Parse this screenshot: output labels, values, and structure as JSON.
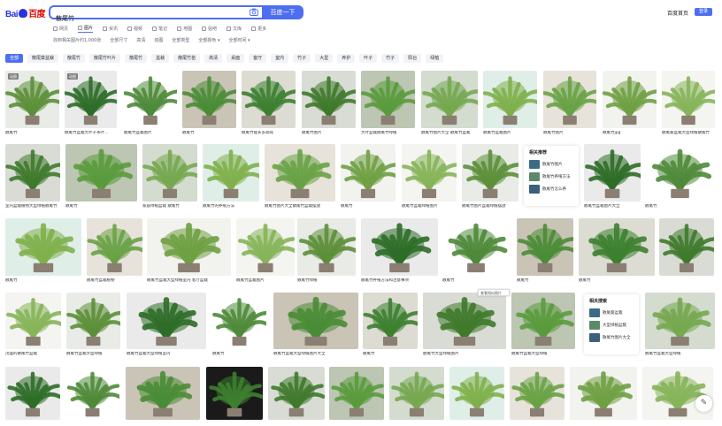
{
  "header": {
    "logo_bai": "Bai",
    "logo_du": "百度",
    "search_value": "散尾竹",
    "search_button": "百度一下",
    "top_link": "百度首页",
    "login": "登录"
  },
  "nav_tabs": [
    {
      "label": "网页",
      "active": false
    },
    {
      "label": "图片",
      "active": true
    },
    {
      "label": "资讯",
      "active": false
    },
    {
      "label": "视频",
      "active": false
    },
    {
      "label": "笔记",
      "active": false
    },
    {
      "label": "地图",
      "active": false
    },
    {
      "label": "贴吧",
      "active": false
    },
    {
      "label": "文库",
      "active": false
    },
    {
      "label": "更多",
      "active": false
    }
  ],
  "filters": [
    "找到相关图片约1,000张",
    "全部尺寸",
    "高清",
    "动图",
    "全部类型",
    "全部颜色 ▾",
    "全部时间 ▾"
  ],
  "chips": [
    "全部",
    "散尾葵盆栽",
    "散尾竹",
    "散尾竹叶片",
    "散尾竹",
    "盆栽",
    "散尾竹苗",
    "高清",
    "桌面",
    "客厅",
    "室内",
    "竹子",
    "大型",
    "养护",
    "叶子",
    "竹子",
    "阳台",
    "绿植"
  ],
  "captions_row1": [
    "散尾竹",
    "散尾竹盆栽大叶子茶叶...",
    "散尾竹盆栽图片",
    "散尾竹",
    "散尾竹能长多高呢",
    "散尾竹图片",
    "大叶盆栽散尾竹绿植",
    "散尾竹图片大全 散尾竹盆栽",
    "散尾竹盆栽图片",
    "散尾竹图片",
    "散尾竹jpg",
    "散尾葵盆栽大型绿植散尾竹"
  ],
  "captions_row2": [
    "室内盆栽植物大型绿植散尾竹",
    "散尾竹",
    "家居绿植盆栽 散尾竹",
    "散尾竹的养殖方法",
    "散尾竹图片大全散尾竹盆栽摆放",
    "散尾竹",
    "散尾竹盆栽绿植图片",
    "散尾竹图片盆栽绿植摆放",
    "散尾竹盆栽图片大全",
    "散尾竹"
  ],
  "captions_row3": [
    "散尾竹",
    "散尾竹盆栽植物",
    "散尾竹盆栽大型绿植室内 客厅盆栽",
    "散尾竹盆栽图片",
    "散尾竹绿植",
    "散尾竹养殖方法和注意事项",
    "散尾竹",
    "散尾竹",
    "散尾竹"
  ],
  "captions_row4": [
    "茂盛的散尾竹盆栽",
    "散尾竹盆栽大型绿植",
    "散尾竹盆栽大型绿植室内",
    "散尾竹",
    "散尾竹盆栽大型绿植图片大全",
    "散尾竹",
    "散尾竹大型绿植图片",
    "散尾竹盆栽大型绿植",
    "散尾竹盆栽大型绿植"
  ],
  "related1": {
    "title": "相关推荐",
    "items": [
      "散尾竹图片",
      "散尾竹养殖方法",
      "散尾竹怎么养"
    ]
  },
  "related2": {
    "title": "相关搜索",
    "items": [
      "散尾葵盆栽",
      "大型绿植盆栽",
      "散尾竹图片大全"
    ]
  },
  "tooltip": "查看相似图片",
  "badge": "动图",
  "icons": {
    "camera": "camera-icon",
    "feedback": "pencil-icon"
  },
  "colors": {
    "brand_blue": "#4e6ef2",
    "logo_blue": "#2932e1",
    "logo_red": "#e10602"
  }
}
